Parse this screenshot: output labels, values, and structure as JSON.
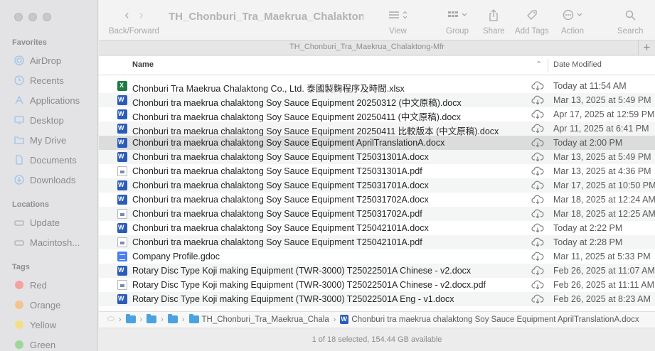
{
  "window": {
    "title": "TH_Chonburi_Tra_Maekrua_Chalakton...",
    "tab_title": "TH_Chonburi_Tra_Maekrua_Chalaktong-Mfr"
  },
  "toolbar": {
    "back_forward": "Back/Forward",
    "view": "View",
    "group": "Group",
    "share": "Share",
    "add_tags": "Add Tags",
    "action": "Action",
    "search": "Search"
  },
  "sidebar": {
    "favorites_label": "Favorites",
    "favorites": [
      {
        "label": "AirDrop",
        "icon": "airdrop-icon"
      },
      {
        "label": "Recents",
        "icon": "clock-icon"
      },
      {
        "label": "Applications",
        "icon": "applications-icon"
      },
      {
        "label": "Desktop",
        "icon": "desktop-icon"
      },
      {
        "label": "My Drive",
        "icon": "folder-icon"
      },
      {
        "label": "Documents",
        "icon": "document-icon"
      },
      {
        "label": "Downloads",
        "icon": "download-icon"
      }
    ],
    "locations_label": "Locations",
    "locations": [
      {
        "label": "Update",
        "icon": "drive-icon"
      },
      {
        "label": "Macintosh...",
        "icon": "drive-icon"
      }
    ],
    "tags_label": "Tags",
    "tags": [
      {
        "label": "Red",
        "color": "#f2a3a0"
      },
      {
        "label": "Orange",
        "color": "#f5c48e"
      },
      {
        "label": "Yellow",
        "color": "#f3df88"
      },
      {
        "label": "Green",
        "color": "#9fd79a"
      }
    ]
  },
  "columns": {
    "name": "Name",
    "date_modified": "Date Modified"
  },
  "files": [
    {
      "name": "Chonburi Tra Maekrua Chalaktong Co., Ltd. 泰國製麴程序及時間.xlsx",
      "date": "Today at 11:54 AM",
      "type": "xlsx"
    },
    {
      "name": "Chonburi tra maekrua chalaktong Soy Sauce Equipment 20250312 (中文原稿).docx",
      "date": "Mar 13, 2025 at 5:49 PM",
      "type": "docx"
    },
    {
      "name": "Chonburi tra maekrua chalaktong Soy Sauce Equipment 20250411 (中文原稿).docx",
      "date": "Apr 17, 2025 at 12:59 PM",
      "type": "docx"
    },
    {
      "name": "Chonburi tra maekrua chalaktong Soy Sauce Equipment 20250411 比較版本 (中文原稿).docx",
      "date": "Apr 11, 2025 at 6:41 PM",
      "type": "docx"
    },
    {
      "name": "Chonburi tra maekrua chalaktong Soy Sauce Equipment AprilTranslationA.docx",
      "date": "Today at 2:00 PM",
      "type": "docx",
      "selected": true
    },
    {
      "name": "Chonburi tra maekrua chalaktong Soy Sauce Equipment T25031301A.docx",
      "date": "Mar 13, 2025 at 5:49 PM",
      "type": "docx"
    },
    {
      "name": "Chonburi tra maekrua chalaktong Soy Sauce Equipment T25031301A.pdf",
      "date": "Mar 13, 2025 at 4:36 PM",
      "type": "pdf"
    },
    {
      "name": "Chonburi tra maekrua chalaktong Soy Sauce Equipment T25031701A.docx",
      "date": "Mar 17, 2025 at 10:50 PM",
      "type": "docx"
    },
    {
      "name": "Chonburi tra maekrua chalaktong Soy Sauce Equipment T25031702A.docx",
      "date": "Mar 18, 2025 at 12:24 AM",
      "type": "docx"
    },
    {
      "name": "Chonburi tra maekrua chalaktong Soy Sauce Equipment T25031702A.pdf",
      "date": "Mar 18, 2025 at 12:25 AM",
      "type": "pdf"
    },
    {
      "name": "Chonburi tra maekrua chalaktong Soy Sauce Equipment T25042101A.docx",
      "date": "Today at 2:22 PM",
      "type": "docx"
    },
    {
      "name": "Chonburi tra maekrua chalaktong Soy Sauce Equipment T25042101A.pdf",
      "date": "Today at 2:28 PM",
      "type": "pdf"
    },
    {
      "name": "Company Profile.gdoc",
      "date": "Mar 11, 2025 at 5:33 PM",
      "type": "gdoc"
    },
    {
      "name": "Rotary Disc Type Koji making Equipment (TWR-3000) T25022501A Chinese - v2.docx",
      "date": "Feb 26, 2025 at 11:07 AM",
      "type": "docx"
    },
    {
      "name": "Rotary Disc Type Koji making Equipment (TWR-3000) T25022501A Chinese - v2.docx.pdf",
      "date": "Feb 26, 2025 at 11:11 AM",
      "type": "pdf"
    },
    {
      "name": "Rotary Disc Type Koji making Equipment (TWR-3000) T25022501A Eng - v1.docx",
      "date": "Feb 26, 2025 at 8:23 AM",
      "type": "docx"
    }
  ],
  "pathbar": {
    "folder_name": "TH_Chonburi_Tra_Maekrua_Chala",
    "file_name": "Chonburi tra maekrua chalaktong Soy Sauce Equipment AprilTranslationA.docx"
  },
  "status": "1 of 18 selected, 154.44 GB available"
}
